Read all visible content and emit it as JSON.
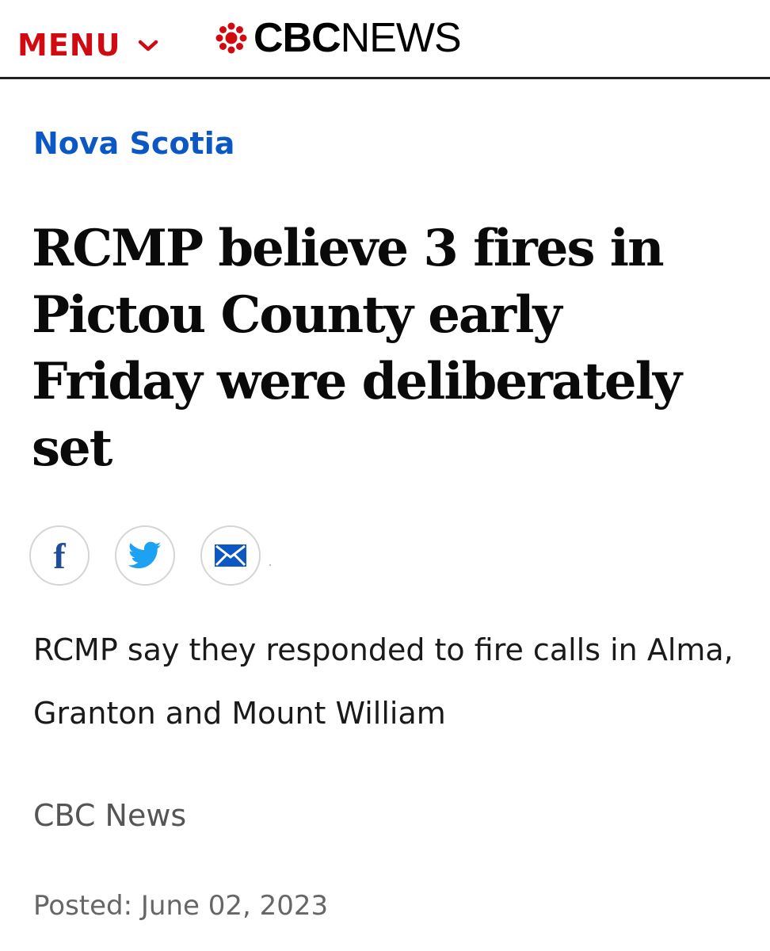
{
  "header": {
    "menu_label": "MENU",
    "logo_cbc": "CBC",
    "logo_news": "NEWS",
    "accent_color": "#d10a11"
  },
  "article": {
    "section": "Nova Scotia",
    "section_color": "#0b57c4",
    "headline": "RCMP believe 3 fires in Pictou County early Friday were deliberately set",
    "dek": "RCMP say they responded to fire calls in Alma, Granton and Mount William",
    "byline": "CBC News",
    "posted": "Posted: June 02, 2023"
  },
  "share": {
    "icons": [
      "facebook-icon",
      "twitter-icon",
      "email-icon"
    ],
    "facebook_color": "#1f4d9b",
    "twitter_color": "#1da1f2",
    "email_color": "#0b57c4"
  }
}
